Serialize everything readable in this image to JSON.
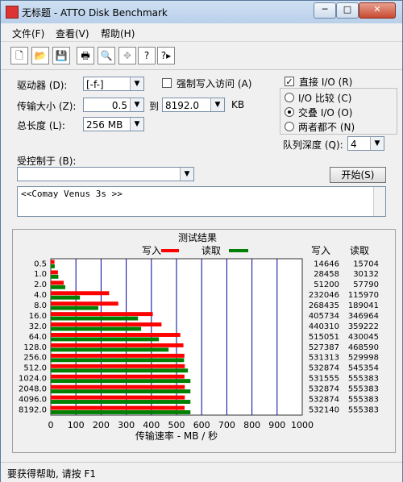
{
  "window": {
    "title": "无标题 - ATTO Disk Benchmark"
  },
  "menu": {
    "file": "文件(F)",
    "view": "查看(V)",
    "help": "帮助(H)"
  },
  "controls": {
    "drive_label": "驱动器 (D):",
    "drive_value": "[-f-]",
    "force_write_label": "强制写入访问 (A)",
    "transfer_label": "传输大小 (Z):",
    "transfer_from": "0.5",
    "to_label": "到",
    "transfer_to": "8192.0",
    "kb_label": "KB",
    "total_label": "总长度 (L):",
    "total_value": "256 MB",
    "direct_io_label": "直接 I/O (R)",
    "io_compare_label": "I/O 比较 (C)",
    "overlap_io_label": "交叠 I/O (O)",
    "neither_label": "两者都不 (N)",
    "queue_label": "队列深度 (Q):",
    "queue_value": "4",
    "controlled_label": "受控制于 (B):",
    "controlled_value": "",
    "start_button": "开始(S)",
    "description": "<<Comay Venus 3s >>"
  },
  "results": {
    "title": "测试结果",
    "write_legend": "写入",
    "read_legend": "读取",
    "write_header": "写入",
    "read_header": "读取",
    "x_axis_label": "传输速率 - MB / 秒"
  },
  "chart_data": {
    "type": "bar",
    "title": "测试结果",
    "xlabel": "传输速率 - MB / 秒",
    "ylabel": "",
    "xlim": [
      0,
      1000
    ],
    "xticks": [
      "0",
      "100",
      "200",
      "300",
      "400",
      "500",
      "600",
      "700",
      "800",
      "900",
      "1000"
    ],
    "categories": [
      "0.5",
      "1.0",
      "2.0",
      "4.0",
      "8.0",
      "16.0",
      "32.0",
      "64.0",
      "128.0",
      "256.0",
      "512.0",
      "1024.0",
      "2048.0",
      "4096.0",
      "8192.0"
    ],
    "series": [
      {
        "name": "写入",
        "color": "#ff0000",
        "values_kbps": [
          14646,
          28458,
          51200,
          232046,
          268435,
          405734,
          440310,
          515051,
          527387,
          531313,
          532874,
          531555,
          532874,
          532874,
          532140
        ]
      },
      {
        "name": "读取",
        "color": "#008000",
        "values_kbps": [
          15704,
          30132,
          57790,
          115970,
          189041,
          346964,
          359222,
          430045,
          468590,
          529998,
          545354,
          555383,
          555383,
          555383,
          555383
        ]
      }
    ],
    "grid": true,
    "legend": "top"
  },
  "statusbar": {
    "text": "要获得帮助, 请按 F1"
  },
  "colors": {
    "write": "#ff0000",
    "read": "#008000",
    "chart_bg": "#ffffff",
    "grid": "#0000a0"
  }
}
